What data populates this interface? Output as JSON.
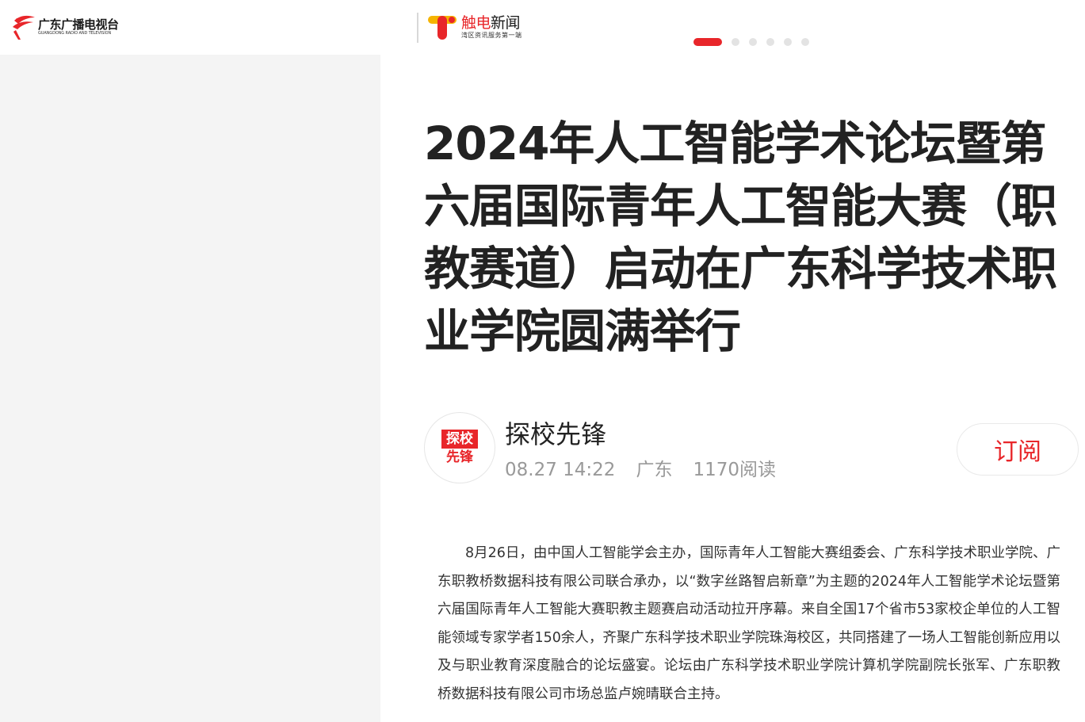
{
  "left_header": {
    "logo_cn": "广东广播电视台",
    "logo_en": "GUANGDONG RADIO AND TELEVISION"
  },
  "app_header": {
    "logo_title_red": "触电",
    "logo_title_black": "新闻",
    "logo_subtitle": "湾区资讯服务第一端",
    "carousel_dots": 6,
    "carousel_active_index": 0
  },
  "article": {
    "title": "2024年人工智能学术论坛暨第六届国际青年人工智能大赛（职教赛道）启动在广东科学技术职业学院圆满举行",
    "author": {
      "avatar_line1": "探校",
      "avatar_line2": "先锋",
      "name": "探校先锋",
      "date": "08.27 14:22",
      "location": "广东",
      "reads": "1170阅读"
    },
    "subscribe_label": "订阅",
    "body": "8月26日，由中国人工智能学会主办，国际青年人工智能大赛组委会、广东科学技术职业学院、广东职教桥数据科技有限公司联合承办，以“数字丝路智启新章”为主题的2024年人工智能学术论坛暨第六届国际青年人工智能大赛职教主题赛启动活动拉开序幕。来自全国17个省市53家校企单位的人工智能领域专家学者150余人，齐聚广东科学技术职业学院珠海校区，共同搭建了一场人工智能创新应用以及与职业教育深度融合的论坛盛宴。论坛由广东科学技术职业学院计算机学院副院长张军、广东职教桥数据科技有限公司市场总监卢婉晴联合主持。"
  },
  "colors": {
    "brand_red": "#e8262a",
    "muted_text": "#999999",
    "left_panel_bg": "#f4f4f4"
  }
}
